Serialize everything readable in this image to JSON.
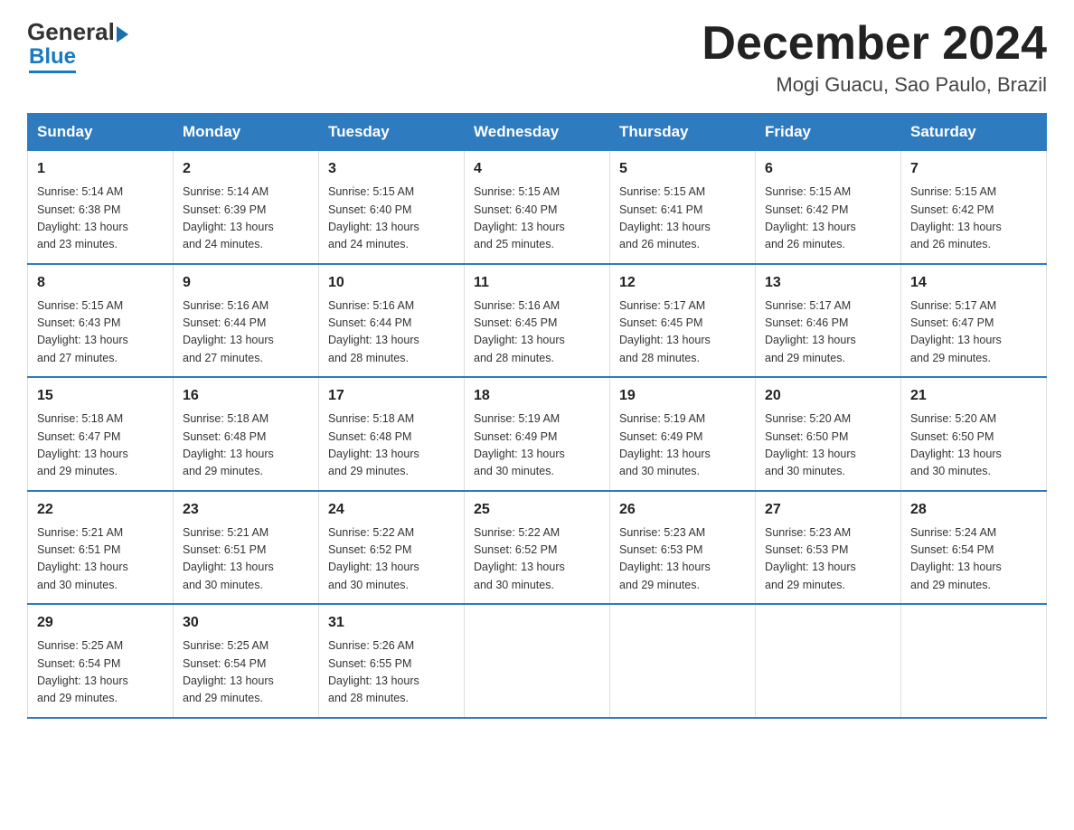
{
  "header": {
    "logo": {
      "line1_general": "General",
      "line1_arrow": "▶",
      "line2_blue": "Blue"
    },
    "title": "December 2024",
    "subtitle": "Mogi Guacu, Sao Paulo, Brazil"
  },
  "calendar": {
    "headers": [
      "Sunday",
      "Monday",
      "Tuesday",
      "Wednesday",
      "Thursday",
      "Friday",
      "Saturday"
    ],
    "weeks": [
      [
        {
          "day": "1",
          "info": "Sunrise: 5:14 AM\nSunset: 6:38 PM\nDaylight: 13 hours\nand 23 minutes."
        },
        {
          "day": "2",
          "info": "Sunrise: 5:14 AM\nSunset: 6:39 PM\nDaylight: 13 hours\nand 24 minutes."
        },
        {
          "day": "3",
          "info": "Sunrise: 5:15 AM\nSunset: 6:40 PM\nDaylight: 13 hours\nand 24 minutes."
        },
        {
          "day": "4",
          "info": "Sunrise: 5:15 AM\nSunset: 6:40 PM\nDaylight: 13 hours\nand 25 minutes."
        },
        {
          "day": "5",
          "info": "Sunrise: 5:15 AM\nSunset: 6:41 PM\nDaylight: 13 hours\nand 26 minutes."
        },
        {
          "day": "6",
          "info": "Sunrise: 5:15 AM\nSunset: 6:42 PM\nDaylight: 13 hours\nand 26 minutes."
        },
        {
          "day": "7",
          "info": "Sunrise: 5:15 AM\nSunset: 6:42 PM\nDaylight: 13 hours\nand 26 minutes."
        }
      ],
      [
        {
          "day": "8",
          "info": "Sunrise: 5:15 AM\nSunset: 6:43 PM\nDaylight: 13 hours\nand 27 minutes."
        },
        {
          "day": "9",
          "info": "Sunrise: 5:16 AM\nSunset: 6:44 PM\nDaylight: 13 hours\nand 27 minutes."
        },
        {
          "day": "10",
          "info": "Sunrise: 5:16 AM\nSunset: 6:44 PM\nDaylight: 13 hours\nand 28 minutes."
        },
        {
          "day": "11",
          "info": "Sunrise: 5:16 AM\nSunset: 6:45 PM\nDaylight: 13 hours\nand 28 minutes."
        },
        {
          "day": "12",
          "info": "Sunrise: 5:17 AM\nSunset: 6:45 PM\nDaylight: 13 hours\nand 28 minutes."
        },
        {
          "day": "13",
          "info": "Sunrise: 5:17 AM\nSunset: 6:46 PM\nDaylight: 13 hours\nand 29 minutes."
        },
        {
          "day": "14",
          "info": "Sunrise: 5:17 AM\nSunset: 6:47 PM\nDaylight: 13 hours\nand 29 minutes."
        }
      ],
      [
        {
          "day": "15",
          "info": "Sunrise: 5:18 AM\nSunset: 6:47 PM\nDaylight: 13 hours\nand 29 minutes."
        },
        {
          "day": "16",
          "info": "Sunrise: 5:18 AM\nSunset: 6:48 PM\nDaylight: 13 hours\nand 29 minutes."
        },
        {
          "day": "17",
          "info": "Sunrise: 5:18 AM\nSunset: 6:48 PM\nDaylight: 13 hours\nand 29 minutes."
        },
        {
          "day": "18",
          "info": "Sunrise: 5:19 AM\nSunset: 6:49 PM\nDaylight: 13 hours\nand 30 minutes."
        },
        {
          "day": "19",
          "info": "Sunrise: 5:19 AM\nSunset: 6:49 PM\nDaylight: 13 hours\nand 30 minutes."
        },
        {
          "day": "20",
          "info": "Sunrise: 5:20 AM\nSunset: 6:50 PM\nDaylight: 13 hours\nand 30 minutes."
        },
        {
          "day": "21",
          "info": "Sunrise: 5:20 AM\nSunset: 6:50 PM\nDaylight: 13 hours\nand 30 minutes."
        }
      ],
      [
        {
          "day": "22",
          "info": "Sunrise: 5:21 AM\nSunset: 6:51 PM\nDaylight: 13 hours\nand 30 minutes."
        },
        {
          "day": "23",
          "info": "Sunrise: 5:21 AM\nSunset: 6:51 PM\nDaylight: 13 hours\nand 30 minutes."
        },
        {
          "day": "24",
          "info": "Sunrise: 5:22 AM\nSunset: 6:52 PM\nDaylight: 13 hours\nand 30 minutes."
        },
        {
          "day": "25",
          "info": "Sunrise: 5:22 AM\nSunset: 6:52 PM\nDaylight: 13 hours\nand 30 minutes."
        },
        {
          "day": "26",
          "info": "Sunrise: 5:23 AM\nSunset: 6:53 PM\nDaylight: 13 hours\nand 29 minutes."
        },
        {
          "day": "27",
          "info": "Sunrise: 5:23 AM\nSunset: 6:53 PM\nDaylight: 13 hours\nand 29 minutes."
        },
        {
          "day": "28",
          "info": "Sunrise: 5:24 AM\nSunset: 6:54 PM\nDaylight: 13 hours\nand 29 minutes."
        }
      ],
      [
        {
          "day": "29",
          "info": "Sunrise: 5:25 AM\nSunset: 6:54 PM\nDaylight: 13 hours\nand 29 minutes."
        },
        {
          "day": "30",
          "info": "Sunrise: 5:25 AM\nSunset: 6:54 PM\nDaylight: 13 hours\nand 29 minutes."
        },
        {
          "day": "31",
          "info": "Sunrise: 5:26 AM\nSunset: 6:55 PM\nDaylight: 13 hours\nand 28 minutes."
        },
        {
          "day": "",
          "info": ""
        },
        {
          "day": "",
          "info": ""
        },
        {
          "day": "",
          "info": ""
        },
        {
          "day": "",
          "info": ""
        }
      ]
    ]
  }
}
